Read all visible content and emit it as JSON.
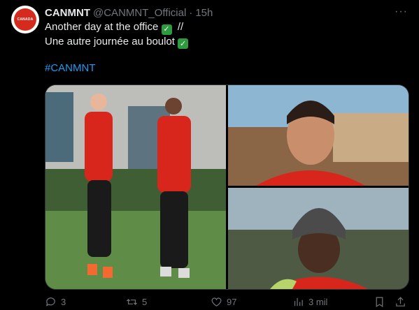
{
  "tweet": {
    "author_name": "CANMNT",
    "handle": "@CANMNT_Official",
    "separator": "·",
    "time": "15h",
    "more": "···",
    "avatar_text": "CANADA",
    "line1": "Another day at the office",
    "line1_sep": "//",
    "line2": "Une autre journée au boulot",
    "check": "✓",
    "hashtag": "#CANMNT"
  },
  "actions": {
    "replies": "3",
    "reposts": "5",
    "likes": "97",
    "views": "3 mil"
  },
  "colors": {
    "background": "#000000",
    "text": "#e7e9ea",
    "muted": "#71767b",
    "link": "#1d9bf0",
    "brand_red": "#d52b1e"
  }
}
